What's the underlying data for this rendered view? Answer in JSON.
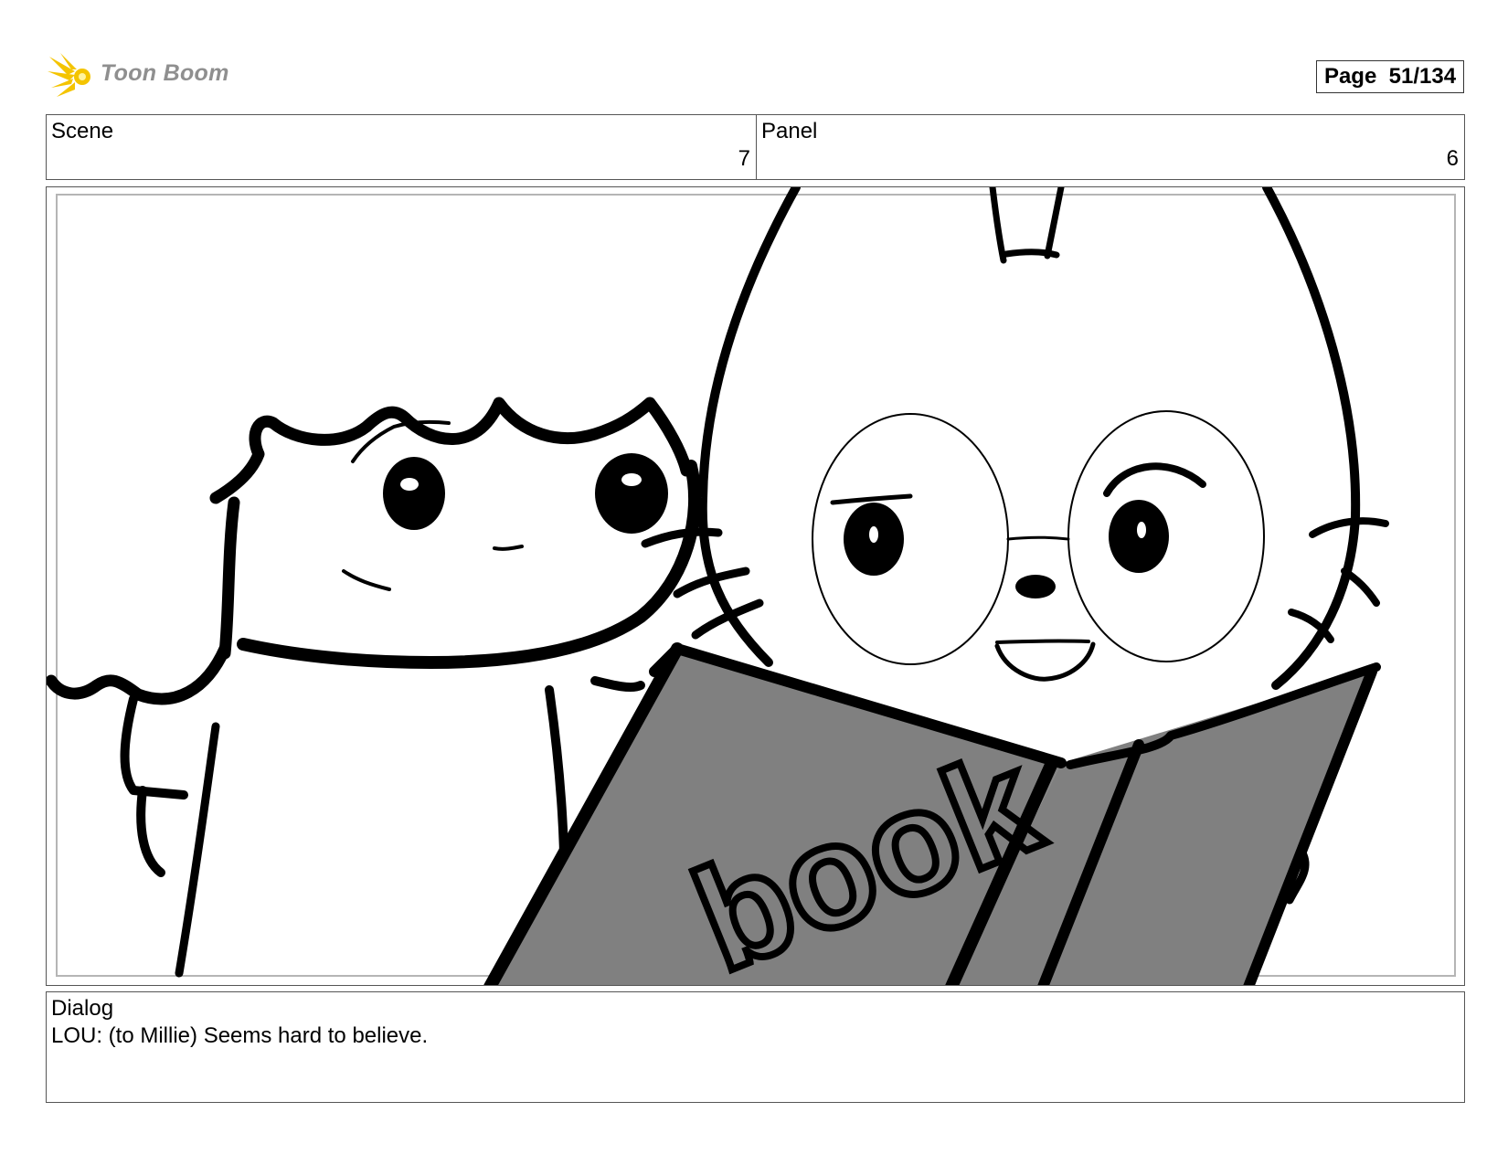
{
  "header": {
    "logo_text": "Toon Boom",
    "page_indicator": "Page  51/134"
  },
  "info": {
    "scene_label": "Scene",
    "scene_value": "7",
    "panel_label": "Panel",
    "panel_value": "6"
  },
  "artwork": {
    "book_text": "book",
    "book_color": "#808080"
  },
  "dialog": {
    "label": "Dialog",
    "text": "LOU: (to Millie) Seems hard to believe."
  }
}
